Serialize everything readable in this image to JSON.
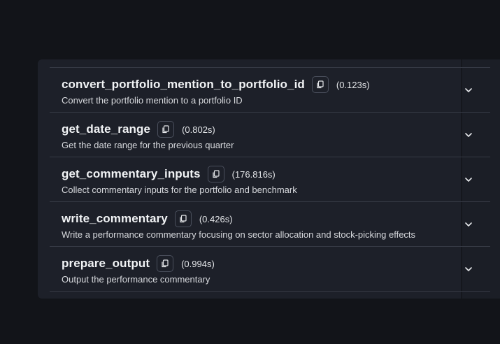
{
  "steps": [
    {
      "name": "convert_portfolio_mention_to_portfolio_id",
      "duration": "(0.123s)",
      "description": "Convert the portfolio mention to a portfolio ID"
    },
    {
      "name": "get_date_range",
      "duration": "(0.802s)",
      "description": "Get the date range for the previous quarter"
    },
    {
      "name": "get_commentary_inputs",
      "duration": "(176.816s)",
      "description": "Collect commentary inputs for the portfolio and benchmark"
    },
    {
      "name": "write_commentary",
      "duration": "(0.426s)",
      "description": "Write a performance commentary focusing on sector allocation and stock-picking effects"
    },
    {
      "name": "prepare_output",
      "duration": "(0.994s)",
      "description": "Output the performance commentary"
    }
  ],
  "icons": {
    "copy": "copy-icon",
    "expand": "chevron-down-icon"
  },
  "colors": {
    "background": "#121419",
    "panel": "#1d2029",
    "divider": "#363a45",
    "text": "#f1f3f5"
  }
}
